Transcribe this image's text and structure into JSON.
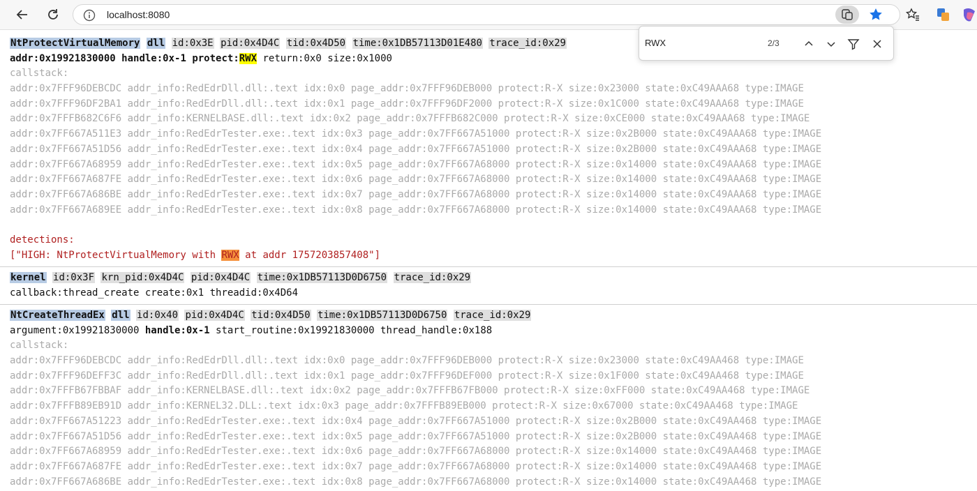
{
  "browser": {
    "url": "localhost:8080",
    "find": {
      "query": "RWX",
      "count": "2/3"
    }
  },
  "events": [
    {
      "header": [
        "NtProtectVirtualMemory",
        "dll",
        "id:0x3E",
        "pid:0x4D4C",
        "tid:0x4D50",
        "time:0x1DB57113D01E480",
        "trace_id:0x29"
      ],
      "args": {
        "addr": "addr:0x19921830000",
        "handle": "handle:0x-1",
        "protect_label": "protect:",
        "protect_value": "RWX",
        "return": "return:0x0",
        "size": "size:0x1000"
      },
      "callstack_label": "callstack:",
      "callstack": [
        "addr:0x7FFF96DEBCDC addr_info:RedEdrDll.dll:.text idx:0x0 page_addr:0x7FFF96DEB000 protect:R-X size:0x23000 state:0xC49AAA68 type:IMAGE",
        "addr:0x7FFF96DF2BA1 addr_info:RedEdrDll.dll:.text idx:0x1 page_addr:0x7FFF96DF2000 protect:R-X size:0x1C000 state:0xC49AAA68 type:IMAGE",
        "addr:0x7FFFB682C6F6 addr_info:KERNELBASE.dll:.text idx:0x2 page_addr:0x7FFFB682C000 protect:R-X size:0xCE000 state:0xC49AAA68 type:IMAGE",
        "addr:0x7FF667A511E3 addr_info:RedEdrTester.exe:.text idx:0x3 page_addr:0x7FF667A51000 protect:R-X size:0x2B000 state:0xC49AAA68 type:IMAGE",
        "addr:0x7FF667A51D56 addr_info:RedEdrTester.exe:.text idx:0x4 page_addr:0x7FF667A51000 protect:R-X size:0x2B000 state:0xC49AAA68 type:IMAGE",
        "addr:0x7FF667A68959 addr_info:RedEdrTester.exe:.text idx:0x5 page_addr:0x7FF667A68000 protect:R-X size:0x14000 state:0xC49AAA68 type:IMAGE",
        "addr:0x7FF667A687FE addr_info:RedEdrTester.exe:.text idx:0x6 page_addr:0x7FF667A68000 protect:R-X size:0x14000 state:0xC49AAA68 type:IMAGE",
        "addr:0x7FF667A686BE addr_info:RedEdrTester.exe:.text idx:0x7 page_addr:0x7FF667A68000 protect:R-X size:0x14000 state:0xC49AAA68 type:IMAGE",
        "addr:0x7FF667A689EE addr_info:RedEdrTester.exe:.text idx:0x8 page_addr:0x7FF667A68000 protect:R-X size:0x14000 state:0xC49AAA68 type:IMAGE"
      ],
      "detections_label": "detections:",
      "detection": {
        "prefix": "[\"HIGH: NtProtectVirtualMemory with ",
        "hit": "RWX",
        "suffix": " at addr 1757203857408\"]"
      }
    },
    {
      "header": [
        "kernel",
        "id:0x3F",
        "krn_pid:0x4D4C",
        "pid:0x4D4C",
        "time:0x1DB57113D0D6750",
        "trace_id:0x29"
      ],
      "line": "callback:thread_create create:0x1 threadid:0x4D64"
    },
    {
      "header": [
        "NtCreateThreadEx",
        "dll",
        "id:0x40",
        "pid:0x4D4C",
        "tid:0x4D50",
        "time:0x1DB57113D0D6750",
        "trace_id:0x29"
      ],
      "args": {
        "argument": "argument:0x19921830000",
        "handle": "handle:0x-1",
        "start_routine": "start_routine:0x19921830000",
        "thread_handle": "thread_handle:0x188"
      },
      "callstack_label": "callstack:",
      "callstack": [
        "addr:0x7FFF96DEBCDC addr_info:RedEdrDll.dll:.text idx:0x0 page_addr:0x7FFF96DEB000 protect:R-X size:0x23000 state:0xC49AA468 type:IMAGE",
        "addr:0x7FFF96DEFF3C addr_info:RedEdrDll.dll:.text idx:0x1 page_addr:0x7FFF96DEF000 protect:R-X size:0x1F000 state:0xC49AA468 type:IMAGE",
        "addr:0x7FFFB67FBBAF addr_info:KERNELBASE.dll:.text idx:0x2 page_addr:0x7FFFB67FB000 protect:R-X size:0xFF000 state:0xC49AA468 type:IMAGE",
        "addr:0x7FFFB89EB91D addr_info:KERNEL32.DLL:.text idx:0x3 page_addr:0x7FFFB89EB000 protect:R-X size:0x67000 state:0xC49AA468 type:IMAGE",
        "addr:0x7FF667A51223 addr_info:RedEdrTester.exe:.text idx:0x4 page_addr:0x7FF667A51000 protect:R-X size:0x2B000 state:0xC49AA468 type:IMAGE",
        "addr:0x7FF667A51D56 addr_info:RedEdrTester.exe:.text idx:0x5 page_addr:0x7FF667A51000 protect:R-X size:0x2B000 state:0xC49AA468 type:IMAGE",
        "addr:0x7FF667A68959 addr_info:RedEdrTester.exe:.text idx:0x6 page_addr:0x7FF667A68000 protect:R-X size:0x14000 state:0xC49AA468 type:IMAGE",
        "addr:0x7FF667A687FE addr_info:RedEdrTester.exe:.text idx:0x7 page_addr:0x7FF667A68000 protect:R-X size:0x14000 state:0xC49AA468 type:IMAGE",
        "addr:0x7FF667A686BE addr_info:RedEdrTester.exe:.text idx:0x8 page_addr:0x7FF667A68000 protect:R-X size:0x14000 state:0xC49AA468 type:IMAGE"
      ]
    }
  ]
}
